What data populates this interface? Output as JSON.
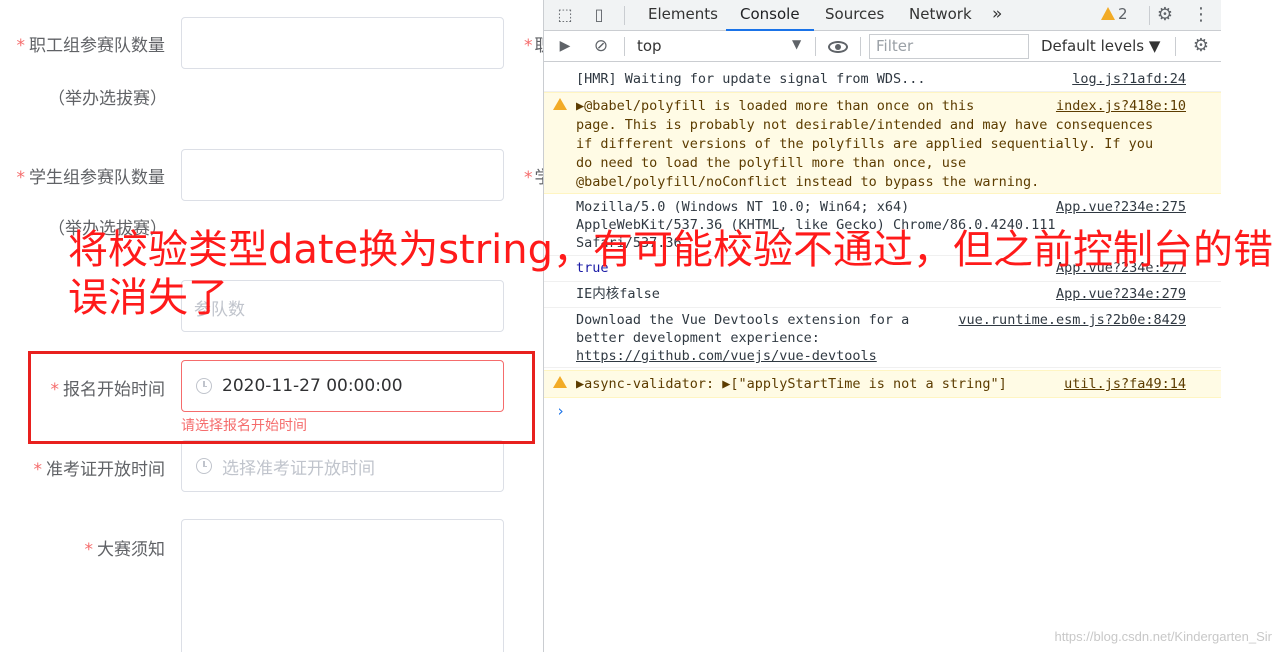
{
  "form": {
    "fields": [
      {
        "label": "职工组参赛队数量",
        "sub": "（举办选拔赛）",
        "required": true
      },
      {
        "label": "学生组参赛队数量",
        "sub": "（举办选拔赛）",
        "required": true
      },
      {
        "label": "",
        "sub": "",
        "partial_text": "参队数"
      },
      {
        "label": "报名开始时间",
        "required": true,
        "value": "2020-11-27 00:00:00",
        "error": "请选择报名开始时间"
      },
      {
        "label": "准考证开放时间",
        "required": true,
        "placeholder": "选择准考证开放时间"
      },
      {
        "label": "大赛须知",
        "required": true
      }
    ],
    "cut_labels": [
      "职",
      "学"
    ],
    "required_mark": "*"
  },
  "devtools": {
    "tabs": [
      "Elements",
      "Console",
      "Sources",
      "Network"
    ],
    "active_tab": "Console",
    "more_tabs": "»",
    "warning_count": "2",
    "context": "top",
    "filter_placeholder": "Filter",
    "levels": "Default levels ▼",
    "logs": [
      {
        "type": "log",
        "lines": [
          "[HMR] Waiting for update signal from WDS..."
        ],
        "source": "log.js?1afd:24"
      },
      {
        "type": "warn",
        "lines": [
          "▶@babel/polyfill is loaded more than once on this",
          "page. This is probably not desirable/intended and may have consequences",
          "if different versions of the polyfills are applied sequentially. If you",
          "do need to load the polyfill more than once, use",
          "@babel/polyfill/noConflict instead to bypass the warning."
        ],
        "source": "index.js?418e:10"
      },
      {
        "type": "log",
        "lines": [
          "Mozilla/5.0 (Windows NT 10.0; Win64; x64)",
          "AppleWebKit/537.36 (KHTML, like Gecko) Chrome/86.0.4240.111",
          "Safari/537.36"
        ],
        "source": "App.vue?234e:275"
      },
      {
        "type": "log",
        "lines": [
          "true"
        ],
        "source": "App.vue?234e:277"
      },
      {
        "type": "log",
        "lines": [
          "IE内核false"
        ],
        "source": "App.vue?234e:279"
      },
      {
        "type": "log",
        "lines": [
          "Download the Vue Devtools extension for a",
          "better development experience:",
          "https://github.com/vuejs/vue-devtools"
        ],
        "source": "vue.runtime.esm.js?2b0e:8429"
      },
      {
        "type": "warn",
        "lines": [
          "▶async-validator: ▶[\"applyStartTime is not a string\"]"
        ],
        "source": "util.js?fa49:14"
      }
    ],
    "prompt": "›"
  },
  "annotation": {
    "text": "将校验类型date换为string，有可能校验不通过，但之前控制台的错误消失了"
  },
  "watermark": "https://blog.csdn.net/Kindergarten_Sir",
  "colors": {
    "required": "#f56c6c",
    "annotation": "#ff1a1a",
    "box": "#e8201e",
    "active_tab": "#1a73e8"
  }
}
